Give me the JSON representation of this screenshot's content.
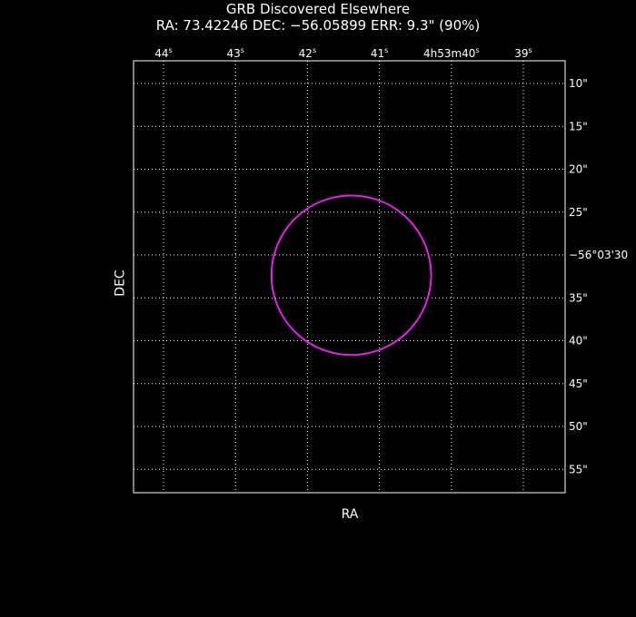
{
  "header": {
    "title": "GRB Discovered Elsewhere",
    "subtitle": "RA: 73.42246  DEC: −56.05899  ERR: 9.3\" (90%)"
  },
  "colors": {
    "background": "#000000",
    "frame": "#ffffff",
    "grid": "#ffffff",
    "circle": "#e91ee9"
  },
  "chart_data": {
    "type": "scatter",
    "title": "GRB Discovered Elsewhere",
    "subtitle": "RA: 73.42246  DEC: −56.05899  ERR: 9.3\" (90%)",
    "xlabel": "RA",
    "ylabel": "DEC",
    "grid": true,
    "x_ticks": [
      {
        "label": "44",
        "sup": "s",
        "ra_sec": 44
      },
      {
        "label": "43",
        "sup": "s",
        "ra_sec": 43
      },
      {
        "label": "42",
        "sup": "s",
        "ra_sec": 42
      },
      {
        "label": "41",
        "sup": "s",
        "ra_sec": 41
      },
      {
        "label": "4h53m40",
        "sup": "s",
        "ra_sec": 40
      },
      {
        "label": "39",
        "sup": "s",
        "ra_sec": 39
      }
    ],
    "y_ticks": [
      {
        "label": "10\"",
        "dec_arcsec": 10
      },
      {
        "label": "15\"",
        "dec_arcsec": 15
      },
      {
        "label": "20\"",
        "dec_arcsec": 20
      },
      {
        "label": "25\"",
        "dec_arcsec": 25
      },
      {
        "label": "−56°03'30",
        "dec_arcsec": 30
      },
      {
        "label": "35\"",
        "dec_arcsec": 35
      },
      {
        "label": "40\"",
        "dec_arcsec": 40
      },
      {
        "label": "45\"",
        "dec_arcsec": 45
      },
      {
        "label": "50\"",
        "dec_arcsec": 50
      },
      {
        "label": "55\"",
        "dec_arcsec": 55
      }
    ],
    "error_circle": {
      "ra_deg": 73.42246,
      "dec_deg": -56.05899,
      "radius_arcsec": 9.3
    }
  }
}
